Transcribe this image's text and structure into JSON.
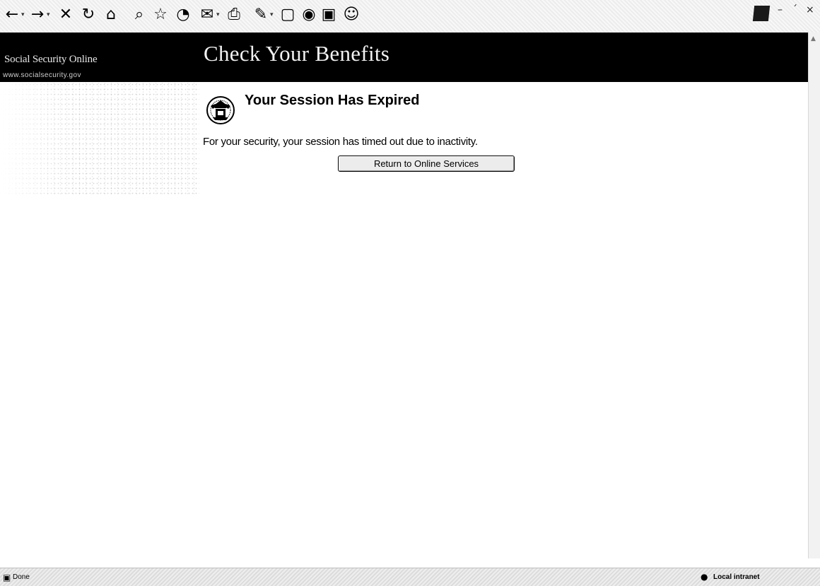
{
  "browser": {
    "toolbar_icons": {
      "back": "←",
      "forward": "→",
      "stop": "✕",
      "refresh": "↻",
      "home": "⌂",
      "search": "⌕",
      "favorites": "☆",
      "history": "◔",
      "mail": "✉",
      "print": "⎙",
      "edit": "✎",
      "discuss": "▢",
      "messenger": "◉",
      "research": "▣",
      "users": "☺",
      "dropdown": "▾"
    },
    "window_controls": {
      "minimize": "–",
      "maximize": "´",
      "close": "×"
    },
    "scroll_up": "▲"
  },
  "banner": {
    "site_name": "Social Security Online",
    "site_url": "www.socialsecurity.gov",
    "title": "Check Your Benefits"
  },
  "content": {
    "title": "Your Session Has Expired",
    "message": "For your security, your session has timed out due to inactivity.",
    "button_label": "Return to Online Services"
  },
  "statusbar": {
    "status_icon": "▣",
    "status_text": "Done",
    "zone_icon": "●",
    "zone_text": "Local intranet"
  }
}
